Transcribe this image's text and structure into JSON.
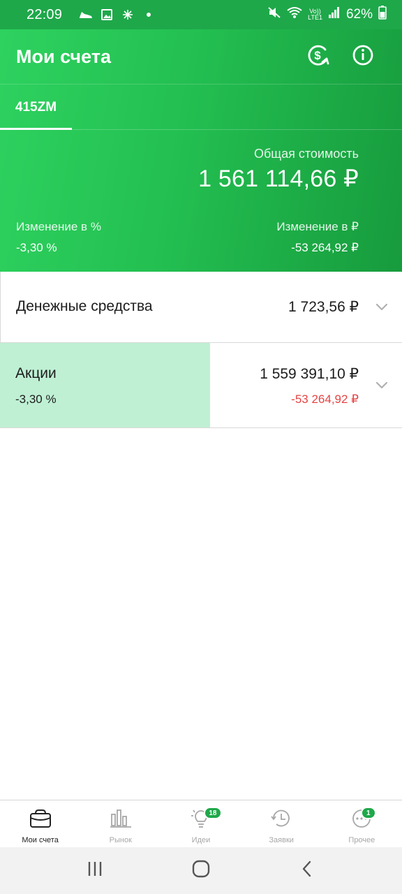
{
  "status_bar": {
    "time": "22:09",
    "notification_icons": [
      "shoe-icon",
      "image-icon",
      "sparkle-icon",
      "dot-icon"
    ],
    "volte_line1": "Vo))",
    "volte_line2": "LTE1",
    "battery": "62%"
  },
  "header": {
    "title": "Мои счета",
    "icons": [
      "currency-exchange-icon",
      "info-icon"
    ]
  },
  "tabs": [
    {
      "label": "415ZM",
      "selected": true
    }
  ],
  "summary": {
    "total_label": "Общая стоимость",
    "total_value": "1 561 114,66 ₽",
    "change_pct_label": "Изменение в  %",
    "change_pct_value": "-3,30  %",
    "change_rub_label": "Изменение в ₽",
    "change_rub_value": "-53 264,92 ₽"
  },
  "rows": {
    "cash": {
      "name": "Денежные средства",
      "amount": "1 723,56 ₽"
    },
    "stocks": {
      "name": "Акции",
      "pct": "-3,30  %",
      "amount": "1 559 391,10 ₽",
      "change": "-53 264,92 ₽"
    }
  },
  "bottom_nav": [
    {
      "label": "Мои счета",
      "icon": "wallet-icon",
      "active": true
    },
    {
      "label": "Рынок",
      "icon": "market-bars-icon"
    },
    {
      "label": "Идеи",
      "icon": "lightbulb-icon",
      "badge": "18"
    },
    {
      "label": "Заявки",
      "icon": "history-clock-icon"
    },
    {
      "label": "Прочее",
      "icon": "more-dots-icon",
      "badge": "1"
    }
  ],
  "colors": {
    "brand_green": "#1ea84a",
    "hero_light": "#2ed25f",
    "hero_dark": "#179b3d",
    "highlight": "#bff0d4",
    "negative": "#e64444"
  }
}
